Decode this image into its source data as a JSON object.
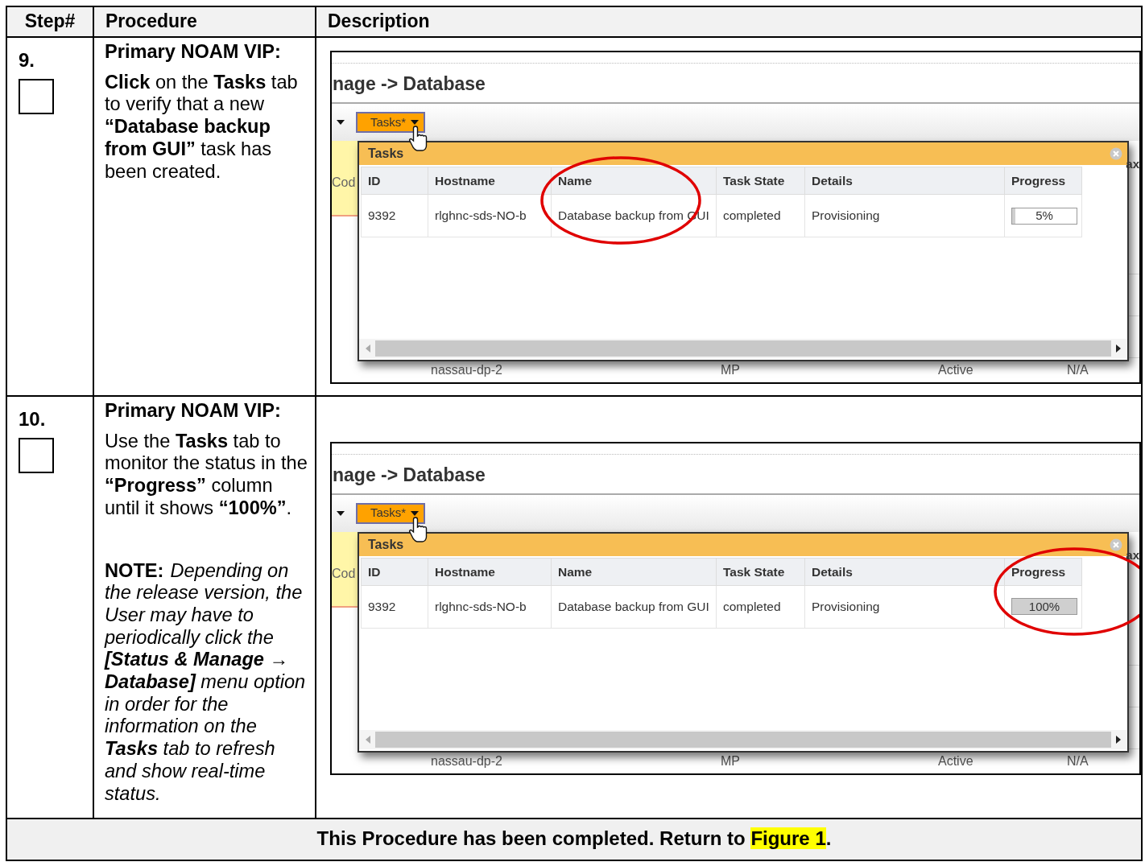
{
  "columns": [
    "Step#",
    "Procedure",
    "Description"
  ],
  "steps": [
    {
      "number": "9.",
      "checked": false,
      "heading": "Primary NOAM VIP:",
      "paragraphs": [
        {
          "kind": "plain",
          "text": "**Click** on the **Tasks** tab to verify that a new **“Database backup from GUI”** task has been created."
        }
      ],
      "screenshot": {
        "page_title": "nage -> Database",
        "tasks_button": "Tasks*",
        "side_cell": "Cod",
        "edge_text": "ax",
        "background_row": [
          "nassau-dp-2",
          "MP",
          "Active",
          "N/A"
        ],
        "popup": {
          "title": "Tasks",
          "columns": [
            {
              "label": "ID",
              "circled": false
            },
            {
              "label": "Hostname",
              "circled": false
            },
            {
              "label": "Name",
              "circled": true
            },
            {
              "label": "Task State",
              "circled": false
            },
            {
              "label": "Details",
              "circled": false
            },
            {
              "label": "Progress",
              "circled": false
            }
          ],
          "rows": [
            {
              "cells": [
                "9392",
                "rlghnc-sds-NO-b",
                "Database backup from GUI",
                "completed",
                "Provisioning"
              ],
              "progress": {
                "level": 0.05,
                "reading": "5%"
              }
            }
          ]
        }
      }
    },
    {
      "number": "10.",
      "checked": false,
      "heading": "Primary NOAM VIP:",
      "paragraphs": [
        {
          "kind": "plain",
          "text": "Use the **Tasks** tab to monitor the status in the **“Progress”** column until it shows **“100%”**."
        },
        {
          "kind": "note",
          "label": "NOTE:",
          "text": "Depending on the release version, the User may have to periodically click the **[Status & Manage → Database]** menu option in order for the information on the **Tasks** tab to refresh and show real-time status."
        }
      ],
      "screenshot": {
        "page_title": "nage -> Database",
        "tasks_button": "Tasks*",
        "side_cell": "Cod",
        "edge_text": "ax",
        "background_row": [
          "nassau-dp-2",
          "MP",
          "Active",
          "N/A"
        ],
        "popup": {
          "title": "Tasks",
          "columns": [
            {
              "label": "ID",
              "circled": false
            },
            {
              "label": "Hostname",
              "circled": false
            },
            {
              "label": "Name",
              "circled": false
            },
            {
              "label": "Task State",
              "circled": false
            },
            {
              "label": "Details",
              "circled": false
            },
            {
              "label": "Progress",
              "circled": true
            }
          ],
          "rows": [
            {
              "cells": [
                "9392",
                "rlghnc-sds-NO-b",
                "Database backup from GUI",
                "completed",
                "Provisioning"
              ],
              "progress": {
                "level": 1,
                "reading": "100%"
              }
            }
          ]
        }
      }
    }
  ],
  "footer": {
    "text": "This Procedure has been completed.  Return to ",
    "link": "Figure 1",
    "end": "."
  }
}
